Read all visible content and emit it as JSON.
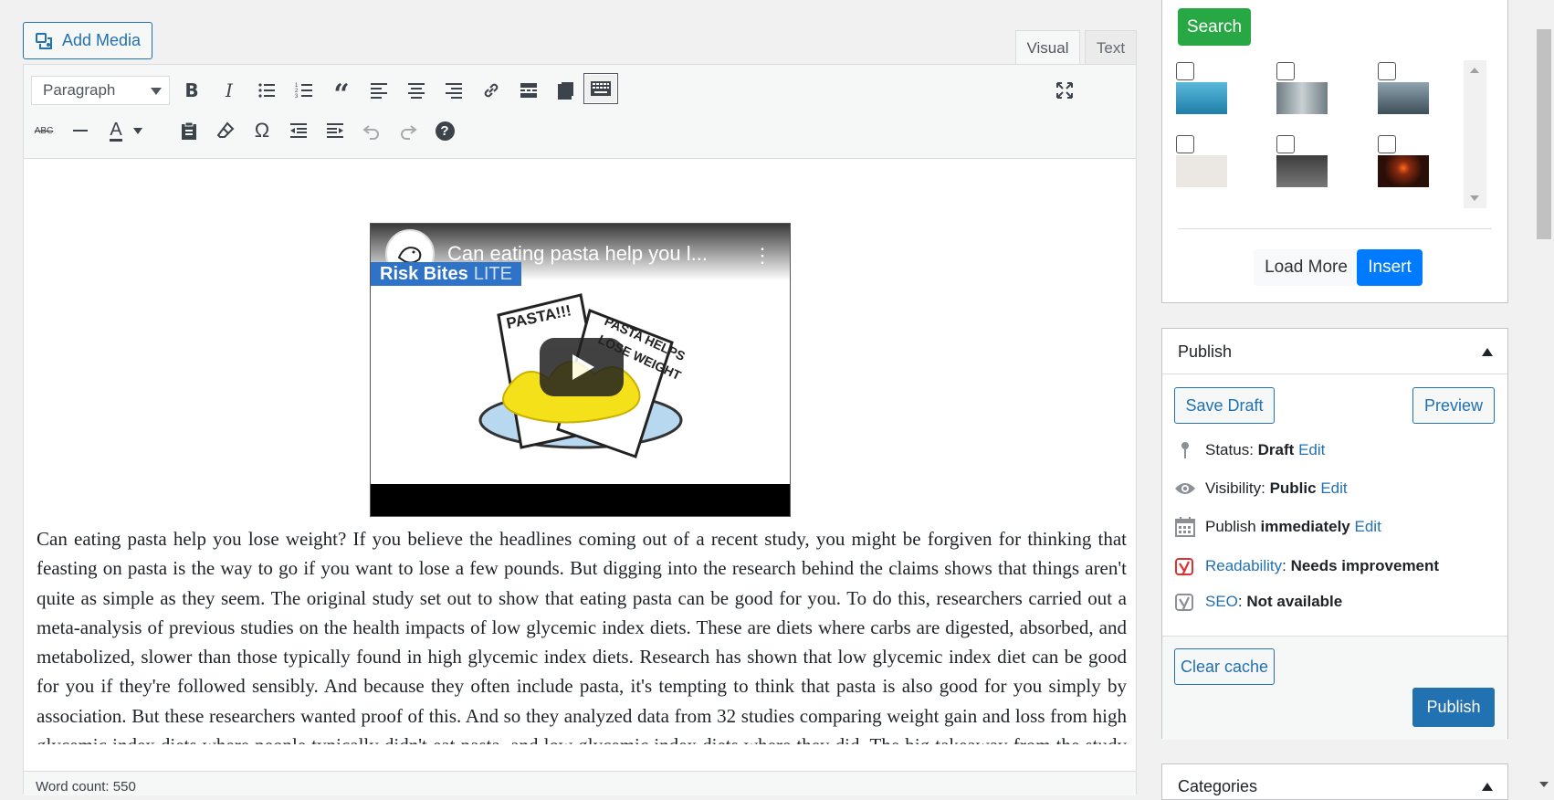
{
  "editor": {
    "add_media_label": "Add Media",
    "tabs": {
      "visual": "Visual",
      "text": "Text"
    },
    "format_select_value": "Paragraph",
    "toolbar_row1": [
      "bold-icon",
      "italic-icon",
      "bullet-list-icon",
      "numbered-list-icon",
      "blockquote-icon",
      "align-left-icon",
      "align-center-icon",
      "align-right-icon",
      "link-icon",
      "read-more-icon",
      "toolbar-toggle-icon",
      "keyboard-icon",
      "fullscreen-icon"
    ],
    "toolbar_row2": [
      "strikethrough-icon",
      "horizontal-line-icon",
      "text-color-icon",
      "paste-text-icon",
      "clear-formatting-icon",
      "special-character-icon",
      "outdent-icon",
      "indent-icon",
      "undo-icon",
      "redo-icon",
      "help-icon"
    ],
    "text_color_letter": "A",
    "strike_label": "ABC",
    "omega": "Ω",
    "help": "?",
    "video": {
      "title": "Can eating pasta help you l...",
      "brand": "Risk Bites",
      "brand_suffix": "LITE",
      "menu": "⋮"
    },
    "body_text": "Can eating pasta help you lose weight? If you believe the headlines coming out of a recent study, you might be forgiven for thinking that feasting on pasta is the way to go if you want to lose a few pounds. But digging into the research behind the claims shows that things aren't quite as simple as they seem. The original study set out to show that eating pasta can be good for you. To do this, researchers carried out a meta-analysis of previous studies on the health impacts of low glycemic index diets. These are diets where carbs are digested, absorbed, and metabolized, slower than those typically found in high glycemic index diets. Research has shown that low glycemic index diet can be good for you if they're followed sensibly. And because they often include pasta, it's tempting to think that pasta is also good for you simply by association. But these researchers wanted proof of this. And so they analyzed data from 32 studies comparing weight gain and loss from high glycemic index diets where people typically didn't eat pasta, and low glycemic index diets where they did. The big takeaway from the study was that if you're eating a healthy diet that contains pasta, it's unlikely to make you fat. So it's good news if",
    "word_count_label": "Word count: 550"
  },
  "media_picker": {
    "search_label": "Search",
    "load_more_label": "Load More",
    "insert_label": "Insert",
    "thumbnails": [
      {
        "name": "thumb-hotel-room",
        "color": "#3aa0c8"
      },
      {
        "name": "thumb-wedding",
        "color": "#8a9aa0"
      },
      {
        "name": "thumb-man-coast",
        "color": "#4a6070"
      },
      {
        "name": "thumb-minimal-figures",
        "color": "#e8e4df"
      },
      {
        "name": "thumb-sneakers",
        "color": "#555555"
      },
      {
        "name": "thumb-sunset",
        "color": "#3a1a10"
      }
    ]
  },
  "publish": {
    "title": "Publish",
    "save_draft_label": "Save Draft",
    "preview_label": "Preview",
    "status_label": "Status:",
    "status_value": "Draft",
    "visibility_label": "Visibility:",
    "visibility_value": "Public",
    "publish_label": "Publish",
    "publish_value": "immediately",
    "edit_label": "Edit",
    "readability_label": "Readability",
    "readability_value": "Needs improvement",
    "seo_label": "SEO",
    "seo_value": "Not available",
    "clear_cache_label": "Clear cache",
    "publish_button_label": "Publish"
  },
  "categories": {
    "title": "Categories"
  },
  "colors": {
    "accent": "#2271b1",
    "search_green": "#28a745",
    "insert_blue": "#007bff",
    "yoast_red": "#dc3232"
  }
}
